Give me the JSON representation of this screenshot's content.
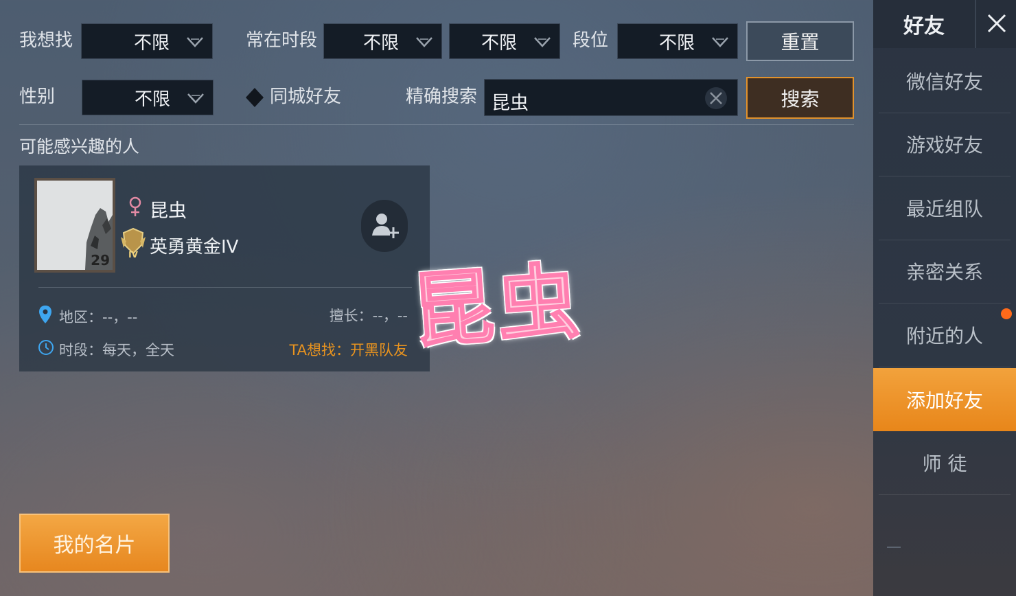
{
  "filters": {
    "looking_for_label": "我想找",
    "looking_for_value": "不限",
    "active_time_label": "常在时段",
    "active_time_value1": "不限",
    "active_time_value2": "不限",
    "rank_label": "段位",
    "rank_value": "不限",
    "reset_label": "重置",
    "gender_label": "性别",
    "gender_value": "不限",
    "same_city_label": "同城好友",
    "exact_search_label": "精确搜索",
    "search_value": "昆虫",
    "search_button": "搜索"
  },
  "suggestions": {
    "heading": "可能感兴趣的人",
    "card": {
      "name": "昆虫",
      "gender": "female",
      "level": "29",
      "rank_badge_text": "IV",
      "rank": "英勇黄金IV",
      "region": "地区：--，--",
      "specialty": "擅长：--，--",
      "time": "时段：每天，全天",
      "seeking": "TA想找：开黑队友"
    }
  },
  "overlay": {
    "text": "昆虫"
  },
  "my_card_button": "我的名片",
  "sidebar": {
    "title": "好友",
    "items": [
      {
        "label": "微信好友",
        "active": false
      },
      {
        "label": "游戏好友",
        "active": false
      },
      {
        "label": "最近组队",
        "active": false
      },
      {
        "label": "亲密关系",
        "active": false
      },
      {
        "label": "附近的人",
        "active": false,
        "badge": true
      },
      {
        "label": "添加好友",
        "active": true
      },
      {
        "label": "师  徒",
        "active": false
      }
    ]
  },
  "colors": {
    "accent": "#e8861a",
    "seek_text": "#e8931f",
    "notification": "#ff6a1a",
    "overlay_pink": "#ff7fb0"
  }
}
